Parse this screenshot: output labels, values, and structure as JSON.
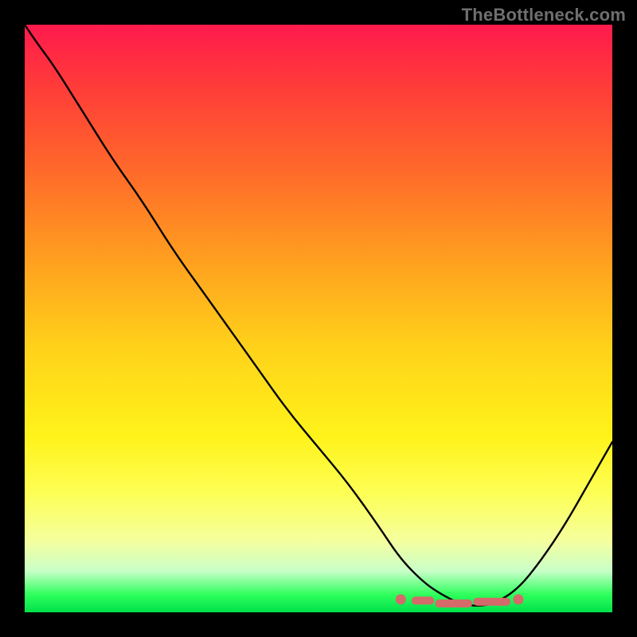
{
  "watermark": "TheBottleneck.com",
  "colors": {
    "bg": "#000000",
    "curve": "#000000",
    "markers": "#d46a6a",
    "gradient_top": "#ff1a4d",
    "gradient_bottom": "#00e04a"
  },
  "chart_data": {
    "type": "line",
    "title": "",
    "xlabel": "",
    "ylabel": "",
    "xlim": [
      0,
      1
    ],
    "ylim": [
      0,
      1
    ],
    "grid": false,
    "legend": false,
    "x": [
      0.0,
      0.02,
      0.05,
      0.1,
      0.15,
      0.2,
      0.25,
      0.3,
      0.35,
      0.4,
      0.45,
      0.5,
      0.55,
      0.6,
      0.64,
      0.68,
      0.71,
      0.74,
      0.77,
      0.8,
      0.84,
      0.88,
      0.92,
      0.96,
      1.0
    ],
    "y": [
      1.0,
      0.97,
      0.93,
      0.85,
      0.77,
      0.7,
      0.62,
      0.55,
      0.48,
      0.41,
      0.34,
      0.28,
      0.22,
      0.15,
      0.09,
      0.05,
      0.03,
      0.015,
      0.01,
      0.015,
      0.04,
      0.09,
      0.15,
      0.22,
      0.29
    ],
    "markers": {
      "dot_xs": [
        0.64,
        0.84
      ],
      "dot_y": 0.022,
      "dash_segments": [
        {
          "x1": 0.665,
          "x2": 0.69,
          "y": 0.02
        },
        {
          "x1": 0.705,
          "x2": 0.755,
          "y": 0.015
        },
        {
          "x1": 0.77,
          "x2": 0.82,
          "y": 0.018
        }
      ]
    },
    "notes": "Gradient background from red (high bottleneck) to green (low bottleneck). Curve minimum around x≈0.77 where markers cluster."
  }
}
